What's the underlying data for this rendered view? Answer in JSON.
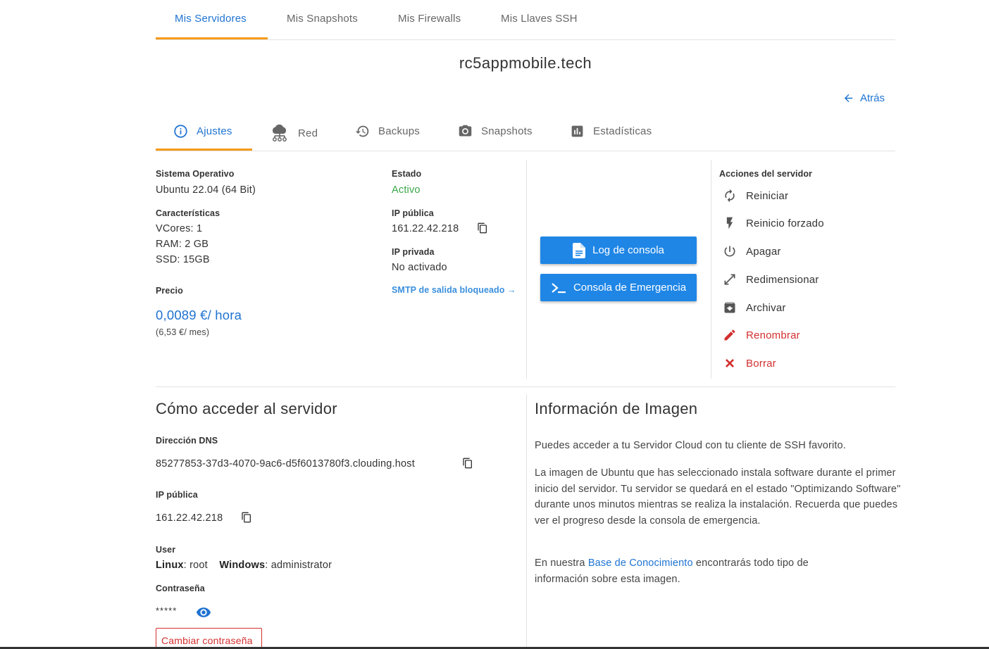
{
  "top_tabs": [
    "Mis Servidores",
    "Mis Snapshots",
    "Mis Firewalls",
    "Mis Llaves SSH"
  ],
  "server_name": "rc5appmobile.tech",
  "back_label": "Atrás",
  "sub_tabs": [
    {
      "label": "Ajustes",
      "icon": "info-icon"
    },
    {
      "label": "Red",
      "icon": "network-icon"
    },
    {
      "label": "Backups",
      "icon": "history-icon"
    },
    {
      "label": "Snapshots",
      "icon": "camera-icon"
    },
    {
      "label": "Estadísticas",
      "icon": "bar-chart-icon"
    }
  ],
  "settings": {
    "os_label": "Sistema Operativo",
    "os_value": "Ubuntu 22.04 (64 Bit)",
    "features_label": "Características",
    "vcores": "VCores: 1",
    "ram": "RAM: 2 GB",
    "ssd": "SSD: 15GB",
    "price_label": "Precio",
    "price_hour": "0,0089 €/ hora",
    "price_month": "(6,53 €/ mes)",
    "state_label": "Estado",
    "state_value": "Activo",
    "public_ip_label": "IP pública",
    "public_ip": "161.22.42.218",
    "private_ip_label": "IP privada",
    "private_ip": "No activado",
    "smtp_link": "SMTP de salida bloqueado →"
  },
  "buttons": {
    "console_log": "Log de consola",
    "emergency_console": "Consola de Emergencia"
  },
  "actions": {
    "title": "Acciones del servidor",
    "items": [
      {
        "label": "Reiniciar",
        "icon": "restart-icon",
        "danger": false
      },
      {
        "label": "Reinicio forzado",
        "icon": "lightning-icon",
        "danger": false
      },
      {
        "label": "Apagar",
        "icon": "power-icon",
        "danger": false
      },
      {
        "label": "Redimensionar",
        "icon": "resize-icon",
        "danger": false
      },
      {
        "label": "Archivar",
        "icon": "archive-icon",
        "danger": false
      },
      {
        "label": "Renombrar",
        "icon": "pencil-icon",
        "danger": true
      },
      {
        "label": "Borrar",
        "icon": "close-icon",
        "danger": true
      }
    ]
  },
  "access": {
    "title": "Cómo acceder al servidor",
    "dns_label": "Dirección DNS",
    "dns_value": "85277853-37d3-4070-9ac6-d5f6013780f3.clouding.host",
    "ip_label": "IP pública",
    "ip_value": "161.22.42.218",
    "user_label": "User",
    "linux_label": "Linux",
    "linux_user": ": root",
    "windows_label": "Windows",
    "windows_user": ": administrator",
    "password_label": "Contraseña",
    "password_value": "*****",
    "change_password": "Cambiar contraseña"
  },
  "image_info": {
    "title": "Información de Imagen",
    "p1": "Puedes acceder a tu Servidor Cloud con tu cliente de SSH favorito.",
    "p2": "La imagen de Ubuntu que has seleccionado instala software durante el primer inicio del servidor. Tu servidor se quedará en el estado \"Optimizando Software\" durante unos minutos mientras se realiza la instalación. Recuerda que puedes ver el progreso desde la consola de emergencia.",
    "p3_before": "En nuestra ",
    "p3_link": "Base de Conocimiento",
    "p3_after": " encontrarás todo tipo de información sobre esta imagen."
  },
  "colors": {
    "accent_blue": "#1f73d1",
    "tab_underline": "#f59b1b",
    "button_blue": "#1f86e6",
    "active_green": "#3aa648",
    "danger_red": "#d32f2f"
  }
}
